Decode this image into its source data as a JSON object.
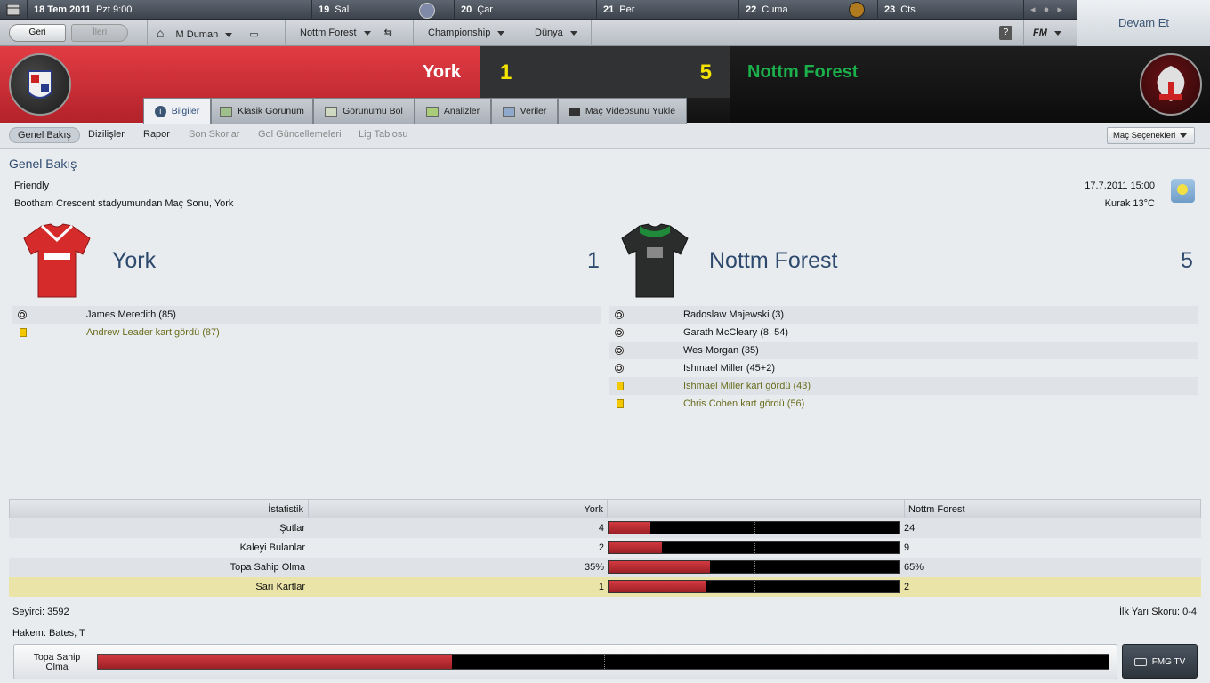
{
  "topbar": {
    "date": "18 Tem 2011",
    "day": "Pzt",
    "time": "9:00",
    "days": [
      {
        "num": "19",
        "name": "Sal"
      },
      {
        "num": "20",
        "name": "Çar"
      },
      {
        "num": "21",
        "name": "Per"
      },
      {
        "num": "22",
        "name": "Cuma"
      },
      {
        "num": "23",
        "name": "Cts"
      }
    ],
    "continue_label": "Devam Et"
  },
  "navbar": {
    "back": "Geri",
    "forward": "İleri",
    "manager": "M Duman",
    "club": "Nottm Forest",
    "competition": "Championship",
    "world": "Dünya",
    "help": "?",
    "fm": "FM"
  },
  "match": {
    "home_team": "York",
    "home_score": "1",
    "away_score": "5",
    "away_team": "Nottm Forest"
  },
  "tabs": [
    {
      "label": "Bilgiler",
      "icon": "info-icon",
      "active": true
    },
    {
      "label": "Klasik Görünüm",
      "icon": "pitch-icon",
      "active": false
    },
    {
      "label": "Görünümü Böl",
      "icon": "split-view-icon",
      "active": false
    },
    {
      "label": "Analizler",
      "icon": "analysis-icon",
      "active": false
    },
    {
      "label": "Veriler",
      "icon": "stats-icon",
      "active": false
    },
    {
      "label": "Maç Videosunu Yükle",
      "icon": "video-icon",
      "active": false
    }
  ],
  "subnav": {
    "items": [
      {
        "label": "Genel Bakış",
        "active": true,
        "enabled": true
      },
      {
        "label": "Dizilişler",
        "active": false,
        "enabled": true
      },
      {
        "label": "Rapor",
        "active": false,
        "enabled": true
      },
      {
        "label": "Son Skorlar",
        "active": false,
        "enabled": false
      },
      {
        "label": "Gol Güncellemeleri",
        "active": false,
        "enabled": false
      },
      {
        "label": "Lig Tablosu",
        "active": false,
        "enabled": false
      }
    ],
    "options": "Maç Seçenekleri"
  },
  "overview": {
    "title": "Genel Bakış",
    "match_type": "Friendly",
    "venue_line": "Bootham Crescent stadyumundan Maç Sonu, York",
    "datetime": "17.7.2011 15:00",
    "weather": "Kurak 13°C"
  },
  "home": {
    "name": "York",
    "score": "1",
    "events": [
      {
        "type": "goal",
        "text": "James Meredith (85)"
      },
      {
        "type": "yellow",
        "text": "Andrew Leader kart gördü (87)"
      }
    ]
  },
  "away": {
    "name": "Nottm Forest",
    "score": "5",
    "events": [
      {
        "type": "goal",
        "text": "Radoslaw Majewski (3)"
      },
      {
        "type": "goal",
        "text": "Garath McCleary (8, 54)"
      },
      {
        "type": "goal",
        "text": "Wes Morgan (35)"
      },
      {
        "type": "goal",
        "text": "Ishmael Miller (45+2)"
      },
      {
        "type": "yellow",
        "text": "Ishmael Miller kart gördü (43)"
      },
      {
        "type": "yellow",
        "text": "Chris Cohen kart gördü (56)"
      }
    ]
  },
  "stats": {
    "header": {
      "label": "İstatistik",
      "home": "York",
      "away": "Nottm Forest"
    },
    "rows": [
      {
        "label": "Şutlar",
        "home": "4",
        "away": "24",
        "home_share": 0.143
      },
      {
        "label": "Kaleyi Bulanlar",
        "home": "2",
        "away": "9",
        "home_share": 0.182
      },
      {
        "label": "Topa Sahip Olma",
        "home": "35%",
        "away": "65%",
        "home_share": 0.35
      },
      {
        "label": "Sarı Kartlar",
        "home": "1",
        "away": "2",
        "home_share": 0.333
      }
    ]
  },
  "footer": {
    "attendance": "Seyirci: 3592",
    "referee": "Hakem: Bates, T",
    "halftime": "İlk Yarı Skoru: 0-4",
    "possession_label": "Topa Sahip Olma",
    "possession_home_share": 0.35,
    "tv_label": "FMG TV"
  }
}
